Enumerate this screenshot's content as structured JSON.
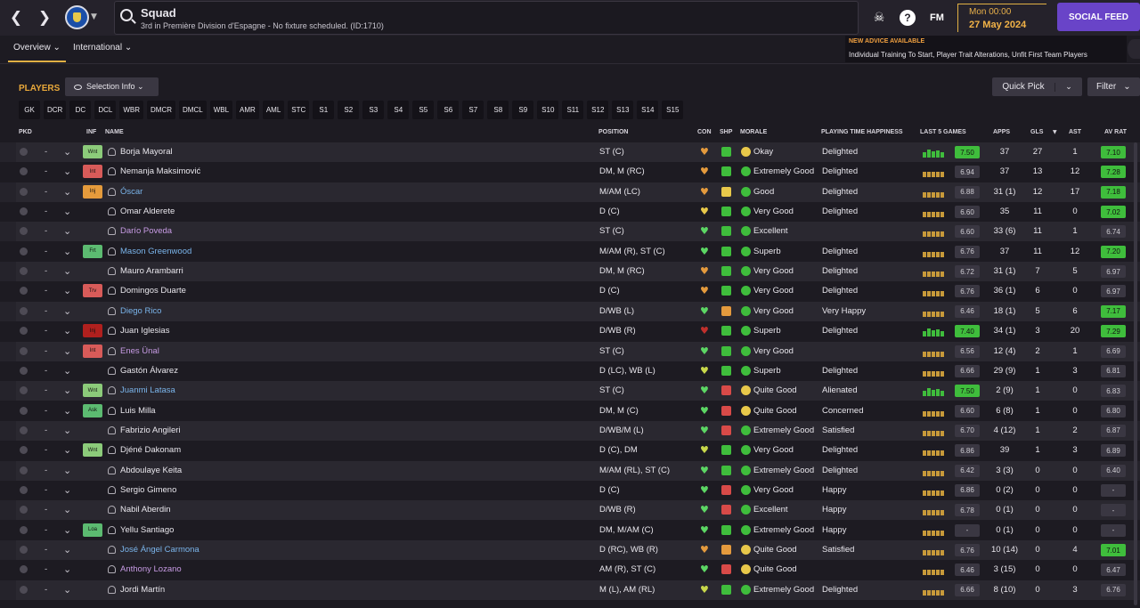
{
  "header": {
    "title": "Squad",
    "subtitle": "3rd in Première Division d'Espagne - No fixture scheduled. (ID:1710)",
    "time": "Mon 00:00",
    "date": "27 May 2024",
    "social": "SOCIAL FEED",
    "fm": "FM"
  },
  "tabs": [
    {
      "label": "Overview ⌄"
    },
    {
      "label": "International ⌄"
    }
  ],
  "advice": {
    "title": "NEW ADVICE AVAILABLE",
    "text": "Individual Training To Start, Player Trait Alterations, Unfit First Team Players"
  },
  "toolbar": {
    "players": "PLAYERS",
    "selection": "Selection Info ⌄",
    "quickpick": "Quick Pick",
    "filter": "Filter",
    "chevron": "⌄"
  },
  "positions": [
    "GK",
    "DCR",
    "DC",
    "DCL",
    "WBR",
    "DMCR",
    "DMCL",
    "WBL",
    "AMR",
    "AML",
    "STC",
    "S1",
    "S2",
    "S3",
    "S4",
    "S5",
    "S6",
    "S7",
    "S8",
    "S9",
    "S10",
    "S11",
    "S12",
    "S13",
    "S14",
    "S15"
  ],
  "columns": {
    "pkd": "PKD",
    "inf": "INF",
    "name": "NAME",
    "position": "POSITION",
    "con": "CON",
    "shp": "SHP",
    "morale": "MORALE",
    "ptHappiness": "PLAYING TIME HAPPINESS",
    "last5": "LAST 5 GAMES",
    "apps": "APPS",
    "gls": "GLS",
    "ast": "AST",
    "avrat": "AV RAT"
  },
  "colors": {
    "accent": "#e0b044",
    "social": "#6944c8",
    "good": "#3fbd3c"
  },
  "players": [
    {
      "inf": "Wnt",
      "name": "Borja Mayoral",
      "pos": "ST (C)",
      "morale": "Okay",
      "pth": "Delighted",
      "last5": "7.50",
      "apps": "37",
      "gls": "27",
      "ast": "1",
      "avr": "7.10"
    },
    {
      "inf": "Int",
      "name": "Nemanja Maksimović",
      "pos": "DM, M (RC)",
      "morale": "Extremely Good",
      "pth": "Delighted",
      "last5": "6.94",
      "apps": "37",
      "gls": "13",
      "ast": "12",
      "avr": "7.28"
    },
    {
      "inf": "Inj",
      "name": "Óscar",
      "pos": "M/AM (LC)",
      "morale": "Good",
      "pth": "Delighted",
      "last5": "6.88",
      "apps": "31 (1)",
      "gls": "12",
      "ast": "17",
      "avr": "7.18"
    },
    {
      "inf": "",
      "name": "Omar Alderete",
      "pos": "D (C)",
      "morale": "Very Good",
      "pth": "Delighted",
      "last5": "6.60",
      "apps": "35",
      "gls": "11",
      "ast": "0",
      "avr": "7.02"
    },
    {
      "inf": "",
      "name": "Darío Poveda",
      "pos": "ST (C)",
      "morale": "Excellent",
      "pth": "",
      "last5": "6.60",
      "apps": "33 (6)",
      "gls": "11",
      "ast": "1",
      "avr": "6.74"
    },
    {
      "inf": "Frt",
      "name": "Mason Greenwood",
      "pos": "M/AM (R), ST (C)",
      "morale": "Superb",
      "pth": "Delighted",
      "last5": "6.76",
      "apps": "37",
      "gls": "11",
      "ast": "12",
      "avr": "7.20"
    },
    {
      "inf": "",
      "name": "Mauro Arambarri",
      "pos": "DM, M (RC)",
      "morale": "Very Good",
      "pth": "Delighted",
      "last5": "6.72",
      "apps": "31 (1)",
      "gls": "7",
      "ast": "5",
      "avr": "6.97"
    },
    {
      "inf": "Trv",
      "name": "Domingos Duarte",
      "pos": "D (C)",
      "morale": "Very Good",
      "pth": "Delighted",
      "last5": "6.76",
      "apps": "36 (1)",
      "gls": "6",
      "ast": "0",
      "avr": "6.97"
    },
    {
      "inf": "",
      "name": "Diego Rico",
      "pos": "D/WB (L)",
      "morale": "Very Good",
      "pth": "Very Happy",
      "last5": "6.46",
      "apps": "18 (1)",
      "gls": "5",
      "ast": "6",
      "avr": "7.17"
    },
    {
      "inf": "Inj",
      "name": "Juan Iglesias",
      "pos": "D/WB (R)",
      "morale": "Superb",
      "pth": "Delighted",
      "last5": "7.40",
      "apps": "34 (1)",
      "gls": "3",
      "ast": "20",
      "avr": "7.29"
    },
    {
      "inf": "Int",
      "name": "Enes Ünal",
      "pos": "ST (C)",
      "morale": "Very Good",
      "pth": "",
      "last5": "6.56",
      "apps": "12 (4)",
      "gls": "2",
      "ast": "1",
      "avr": "6.69"
    },
    {
      "inf": "",
      "name": "Gastón Álvarez",
      "pos": "D (LC), WB (L)",
      "morale": "Superb",
      "pth": "Delighted",
      "last5": "6.66",
      "apps": "29 (9)",
      "gls": "1",
      "ast": "3",
      "avr": "6.81"
    },
    {
      "inf": "Wnt",
      "name": "Juanmi Latasa",
      "pos": "ST (C)",
      "morale": "Quite Good",
      "pth": "Alienated",
      "last5": "7.50",
      "apps": "2 (9)",
      "gls": "1",
      "ast": "0",
      "avr": "6.83"
    },
    {
      "inf": "Ask",
      "name": "Luis Milla",
      "pos": "DM, M (C)",
      "morale": "Quite Good",
      "pth": "Concerned",
      "last5": "6.60",
      "apps": "6 (8)",
      "gls": "1",
      "ast": "0",
      "avr": "6.80"
    },
    {
      "inf": "",
      "name": "Fabrizio Angileri",
      "pos": "D/WB/M (L)",
      "morale": "Extremely Good",
      "pth": "Satisfied",
      "last5": "6.70",
      "apps": "4 (12)",
      "gls": "1",
      "ast": "2",
      "avr": "6.87"
    },
    {
      "inf": "Wnt",
      "name": "Djéné Dakonam",
      "pos": "D (C), DM",
      "morale": "Very Good",
      "pth": "Delighted",
      "last5": "6.86",
      "apps": "39",
      "gls": "1",
      "ast": "3",
      "avr": "6.89"
    },
    {
      "inf": "",
      "name": "Abdoulaye Keita",
      "pos": "M/AM (RL), ST (C)",
      "morale": "Extremely Good",
      "pth": "Delighted",
      "last5": "6.42",
      "apps": "3 (3)",
      "gls": "0",
      "ast": "0",
      "avr": "6.40"
    },
    {
      "inf": "",
      "name": "Sergio Gimeno",
      "pos": "D (C)",
      "morale": "Very Good",
      "pth": "Happy",
      "last5": "6.86",
      "apps": "0 (2)",
      "gls": "0",
      "ast": "0",
      "avr": "-"
    },
    {
      "inf": "",
      "name": "Nabil Aberdin",
      "pos": "D/WB (R)",
      "morale": "Excellent",
      "pth": "Happy",
      "last5": "6.78",
      "apps": "0 (1)",
      "gls": "0",
      "ast": "0",
      "avr": "-"
    },
    {
      "inf": "Loa",
      "name": "Yellu Santiago",
      "pos": "DM, M/AM (C)",
      "morale": "Extremely Good",
      "pth": "Happy",
      "last5": "-",
      "apps": "0 (1)",
      "gls": "0",
      "ast": "0",
      "avr": "-"
    },
    {
      "inf": "",
      "name": "José Ángel Carmona",
      "pos": "D (RC), WB (R)",
      "morale": "Quite Good",
      "pth": "Satisfied",
      "last5": "6.76",
      "apps": "10 (14)",
      "gls": "0",
      "ast": "4",
      "avr": "7.01"
    },
    {
      "inf": "",
      "name": "Anthony Lozano",
      "pos": "AM (R), ST (C)",
      "morale": "Quite Good",
      "pth": "",
      "last5": "6.46",
      "apps": "3 (15)",
      "gls": "0",
      "ast": "0",
      "avr": "6.47"
    },
    {
      "inf": "",
      "name": "Jordi Martín",
      "pos": "M (L), AM (RL)",
      "morale": "Extremely Good",
      "pth": "Delighted",
      "last5": "6.66",
      "apps": "8 (10)",
      "gls": "0",
      "ast": "3",
      "avr": "6.76"
    }
  ]
}
